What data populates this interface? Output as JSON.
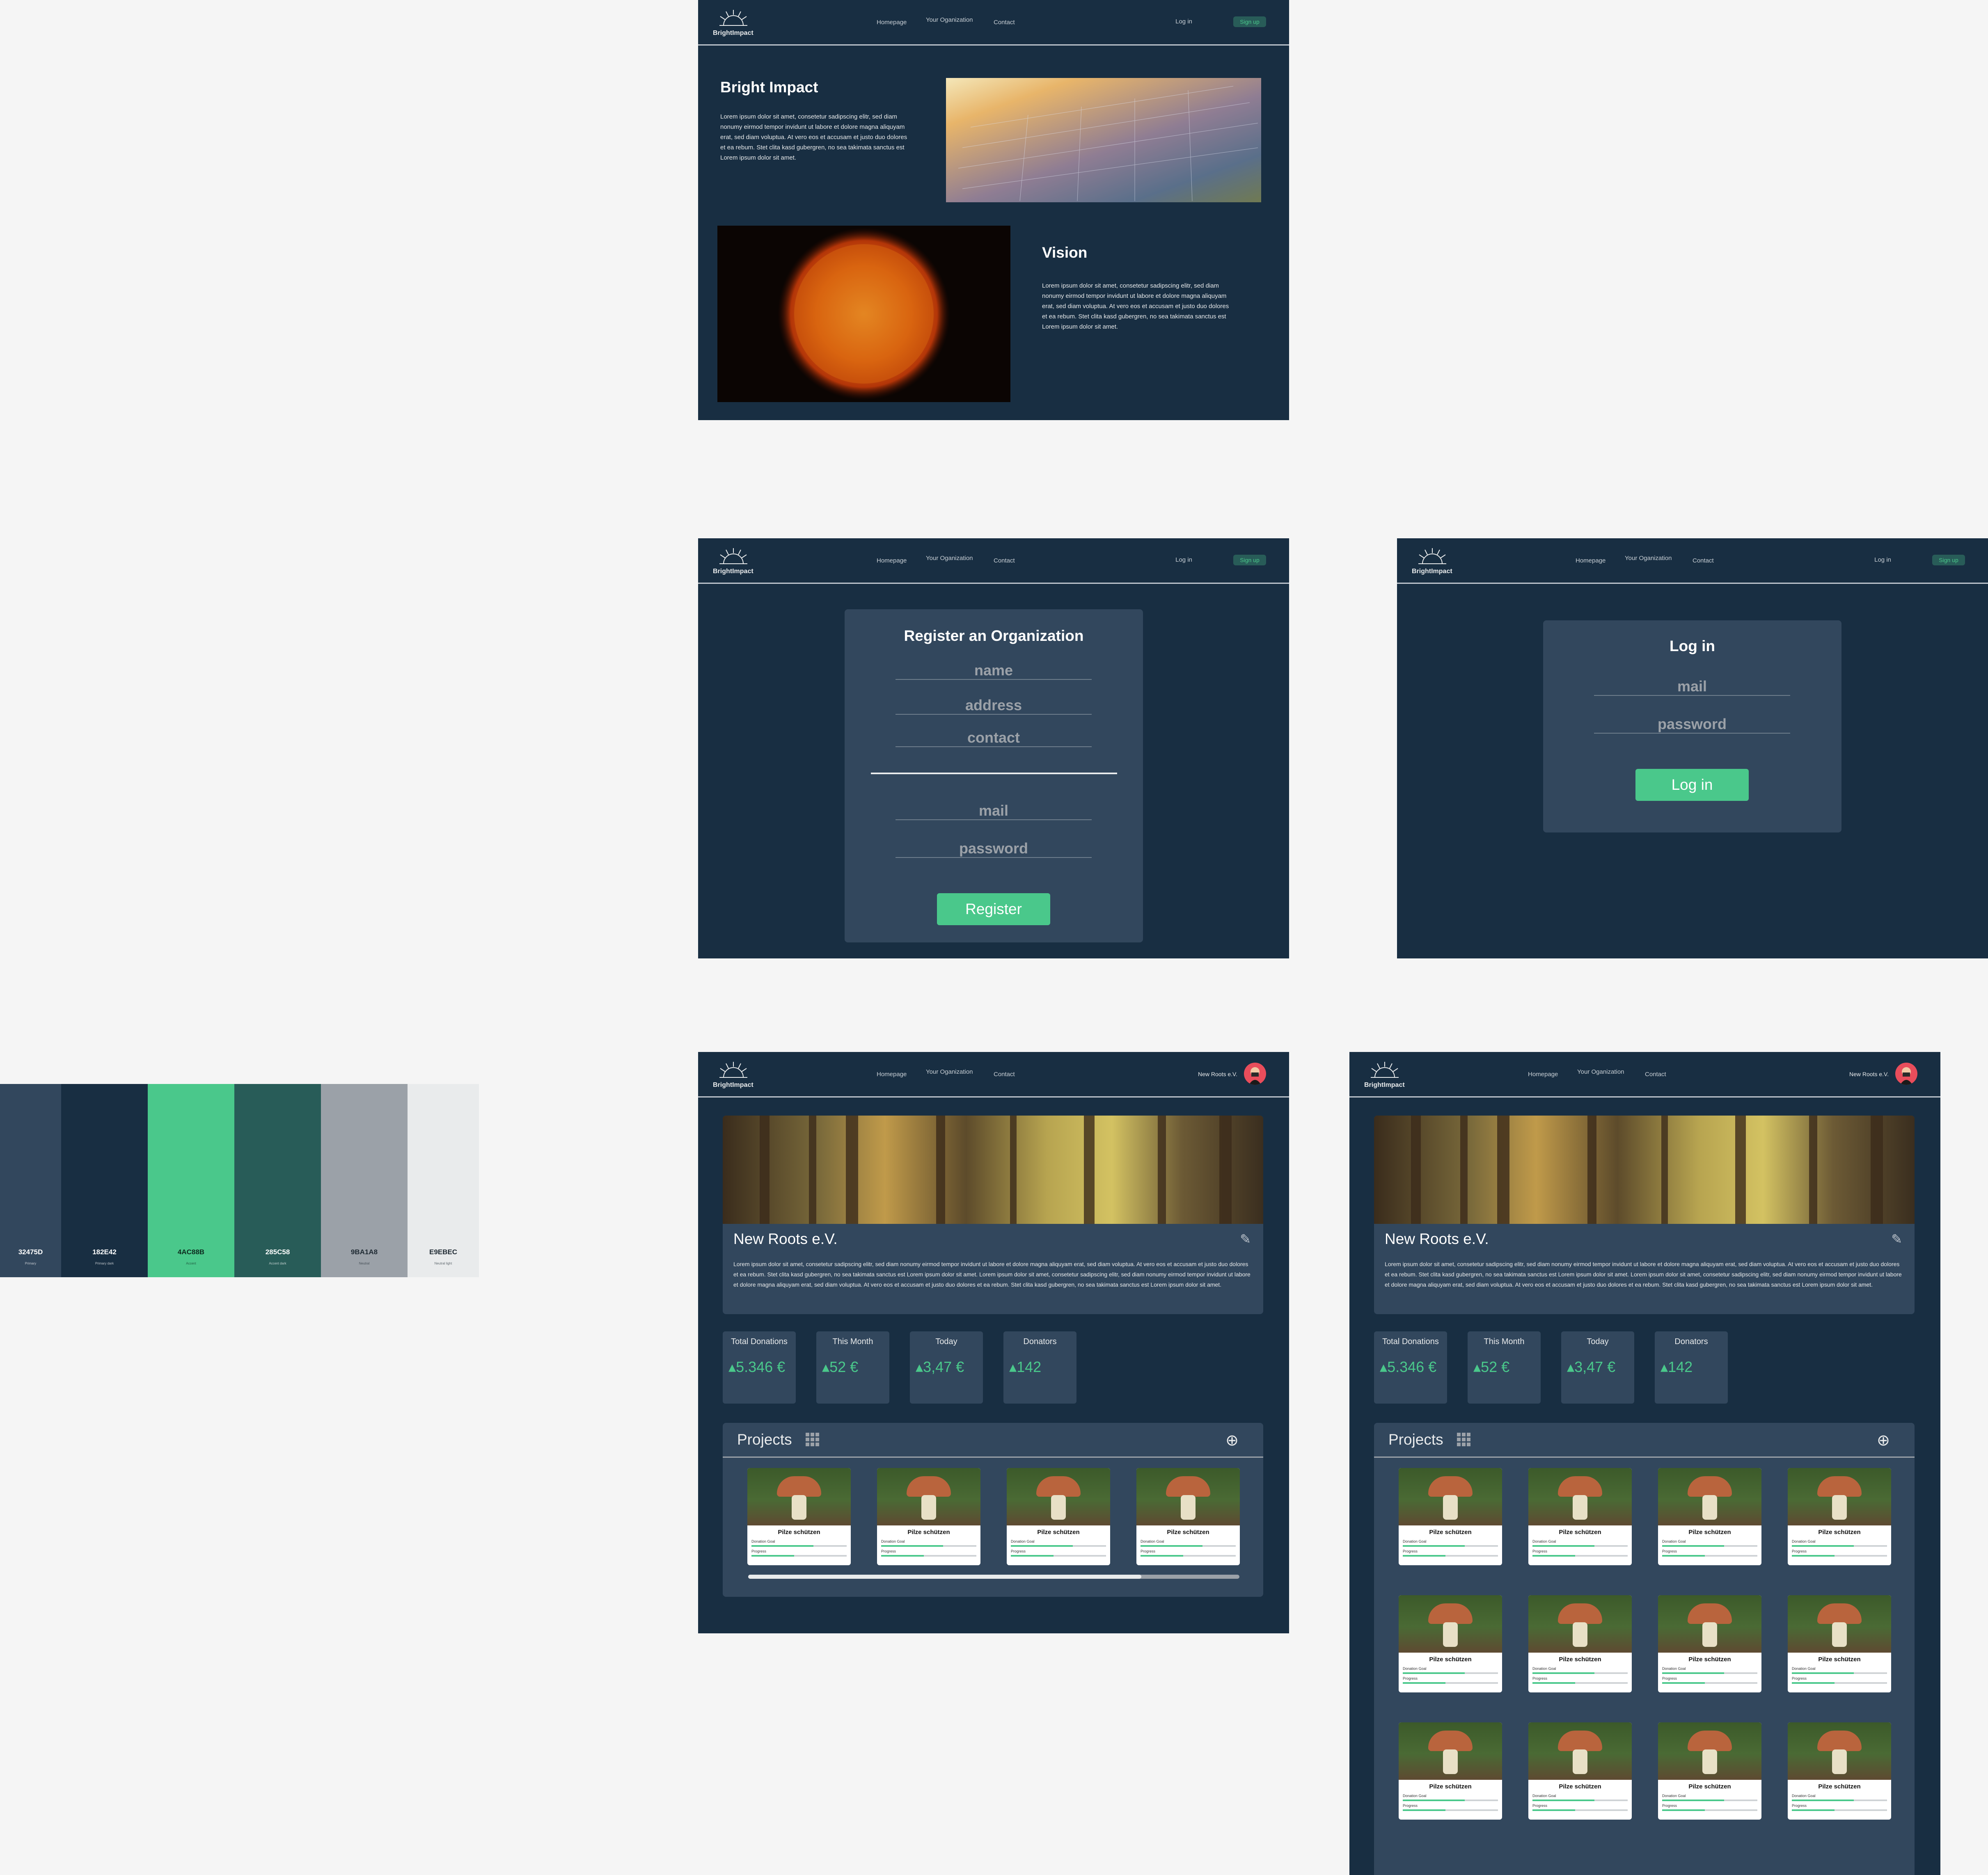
{
  "brand": {
    "name": "BrightImpact"
  },
  "nav": {
    "homepage": "Homepage",
    "organization": "Your Oganization",
    "contact": "Contact",
    "login": "Log in",
    "signup": "Sign up"
  },
  "home": {
    "intro_title": "Bright Impact",
    "intro_text": "Lorem ipsum dolor sit amet, consetetur sadipscing elitr, sed diam nonumy eirmod tempor invidunt ut labore et dolore magna aliquyam erat, sed diam voluptua. At vero eos et accusam et justo duo dolores et ea rebum. Stet clita kasd gubergren, no sea takimata sanctus est Lorem ipsum dolor sit amet.",
    "vision_title": "Vision",
    "vision_text": "Lorem ipsum dolor sit amet, consetetur sadipscing elitr, sed diam nonumy eirmod tempor invidunt ut labore et dolore magna aliquyam erat, sed diam voluptua. At vero eos et accusam et justo duo dolores et ea rebum. Stet clita kasd gubergren, no sea takimata sanctus est Lorem ipsum dolor sit amet."
  },
  "register": {
    "title": "Register an Organization",
    "name_placeholder": "name",
    "address_placeholder": "address",
    "contact_placeholder": "contact",
    "mail_placeholder": "mail",
    "password_placeholder": "password",
    "button": "Register"
  },
  "login_form": {
    "title": "Log in",
    "mail_placeholder": "mail",
    "password_placeholder": "password",
    "button": "Log in"
  },
  "palette": [
    {
      "hex": "32475D",
      "color": "#32475D",
      "name": "Primary"
    },
    {
      "hex": "182E42",
      "color": "#182E42",
      "name": "Primary dark"
    },
    {
      "hex": "4AC88B",
      "color": "#4AC88B",
      "name": "Accent"
    },
    {
      "hex": "285C58",
      "color": "#285C58",
      "name": "Accent dark"
    },
    {
      "hex": "9BA1A8",
      "color": "#9BA1A8",
      "name": "Neutral"
    },
    {
      "hex": "E9EBEC",
      "color": "#E9EBEC",
      "name": "Neutral light"
    }
  ],
  "dashboard": {
    "user_name": "New Roots e.V.",
    "org_name": "New Roots e.V.",
    "org_desc": "Lorem ipsum dolor sit amet, consetetur sadipscing elitr, sed diam nonumy eirmod tempor invidunt ut labore et dolore magna aliquyam erat, sed diam voluptua. At vero eos et accusam et justo duo dolores et ea rebum. Stet clita kasd gubergren, no sea takimata sanctus est Lorem ipsum dolor sit amet. Lorem ipsum dolor sit amet, consetetur sadipscing elitr, sed diam nonumy eirmod tempor invidunt ut labore et dolore magna aliquyam erat, sed diam voluptua. At vero eos et accusam et justo duo dolores et ea rebum. Stet clita kasd gubergren, no sea takimata sanctus est Lorem ipsum dolor sit amet.",
    "stats": [
      {
        "label": "Total Donations",
        "value": "▴5.346 €"
      },
      {
        "label": "This Month",
        "value": "▴52 €"
      },
      {
        "label": "Today",
        "value": "▴3,47 €"
      },
      {
        "label": "Donators",
        "value": "▴142"
      }
    ],
    "projects_title": "Projects",
    "project": {
      "title": "Pilze schützen",
      "goal_label": "Donation Goal",
      "progress_label": "Progress",
      "goal_level": 0.65,
      "progress_level": 0.45
    },
    "scroll_level": 0.8
  }
}
